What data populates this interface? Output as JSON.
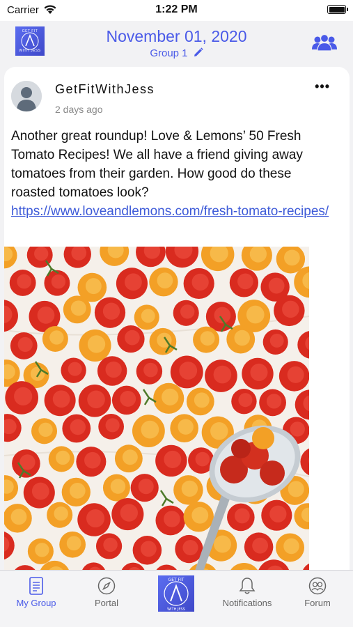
{
  "status_bar": {
    "carrier": "Carrier",
    "time": "1:22 PM"
  },
  "header": {
    "logo_text_top": "GET FIT",
    "logo_text_bottom": "WITH JESS",
    "date": "November 01, 2020",
    "group": "Group 1"
  },
  "post": {
    "author": "GetFitWithJess",
    "time_ago": "2 days ago",
    "more": "•••",
    "text": "Another great roundup! Love & Lemons’ 50 Fresh Tomato Recipes! We all have a friend giving away tomatoes from their garden. How good do these roasted tomatoes look?",
    "link": "https://www.loveandlemons.com/fresh-tomato-recipes/"
  },
  "tabbar": {
    "items": [
      {
        "label": "My Group",
        "icon": "document-icon"
      },
      {
        "label": "Portal",
        "icon": "compass-icon"
      },
      {
        "label": "",
        "icon": "app-logo-icon"
      },
      {
        "label": "Notifications",
        "icon": "bell-icon"
      },
      {
        "label": "Forum",
        "icon": "chat-bubbles-icon"
      }
    ]
  },
  "colors": {
    "accent": "#4a5ae8",
    "link": "#3d5ad8",
    "tomato_red": "#d92b1f",
    "tomato_orange": "#f3a026"
  }
}
